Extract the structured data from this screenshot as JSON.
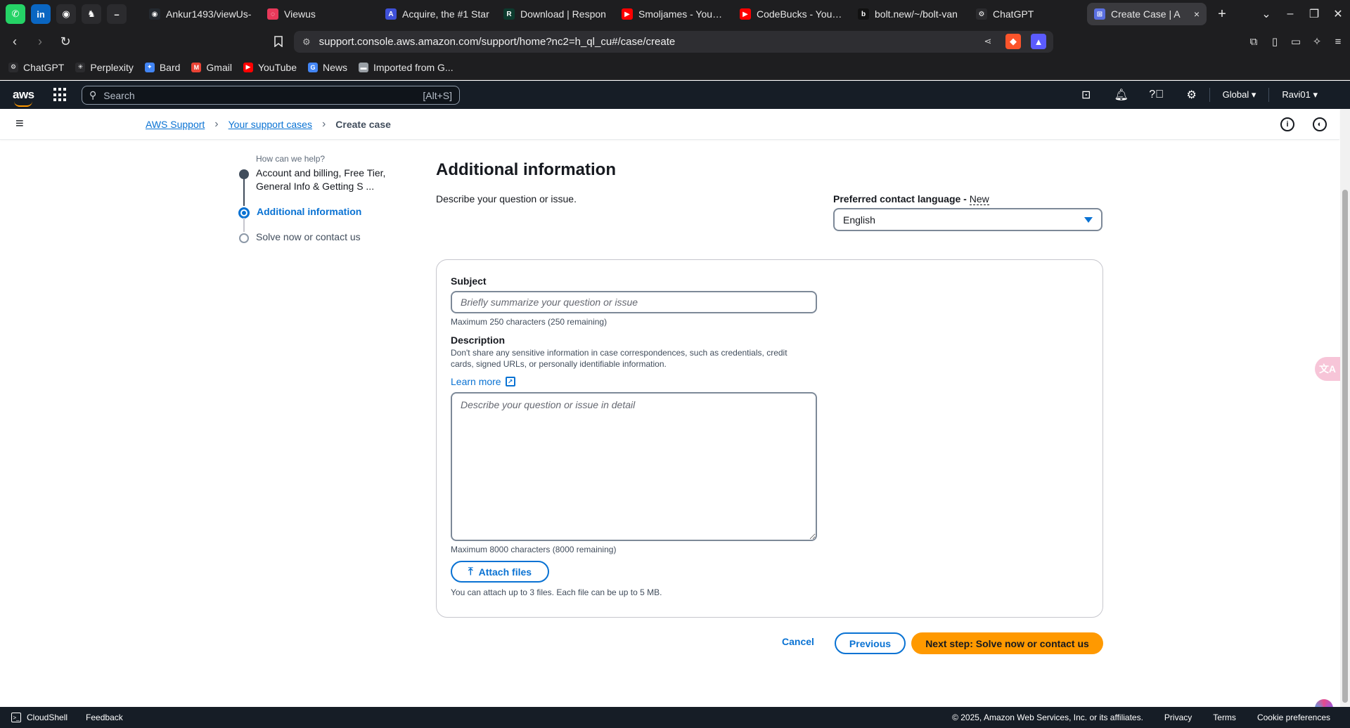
{
  "browser": {
    "pinned": [
      {
        "name": "whatsapp",
        "glyph": "✆",
        "color": "#25d366"
      },
      {
        "name": "linkedin",
        "glyph": "in",
        "color": "#0a66c2"
      },
      {
        "name": "github",
        "glyph": "◉",
        "color": "#2b2b2e"
      },
      {
        "name": "extension",
        "glyph": "♞",
        "color": "#2b2b2e"
      },
      {
        "name": "minimize-app",
        "glyph": "–",
        "color": "#2b2b2e"
      }
    ],
    "tabs": [
      {
        "label": "Ankur1493/viewUs-",
        "fav": "◉",
        "favcolor": "#24292f"
      },
      {
        "label": "Viewus",
        "fav": "◌",
        "favcolor": "#e8395a"
      },
      {
        "label": "Acquire, the #1 Star",
        "fav": "A",
        "favcolor": "#3f51d9"
      },
      {
        "label": "Download | Respon",
        "fav": "R",
        "favcolor": "#0d3b2e"
      },
      {
        "label": "Smoljames - YouTub",
        "fav": "▶",
        "favcolor": "#ff0000"
      },
      {
        "label": "CodeBucks - YouTub",
        "fav": "▶",
        "favcolor": "#ff0000"
      },
      {
        "label": "bolt.new/~/bolt-van",
        "fav": "b",
        "favcolor": "#111111"
      },
      {
        "label": "ChatGPT",
        "fav": "⚙",
        "favcolor": "#2b2b2e"
      },
      {
        "label": "Create Case | A",
        "fav": "⊞",
        "favcolor": "#5a6fe0",
        "active": true
      }
    ],
    "url": "support.console.aws.amazon.com/support/home?nc2=h_ql_cu#/case/create",
    "bookmarks": [
      {
        "label": "ChatGPT",
        "icon": "⚙",
        "color": "#2b2b2e"
      },
      {
        "label": "Perplexity",
        "icon": "✳",
        "color": "#2b2b2e"
      },
      {
        "label": "Bard",
        "icon": "✦",
        "color": "#4285f4"
      },
      {
        "label": "Gmail",
        "icon": "M",
        "color": "#ea4335"
      },
      {
        "label": "YouTube",
        "icon": "▶",
        "color": "#ff0000"
      },
      {
        "label": "News",
        "icon": "G",
        "color": "#4285f4"
      },
      {
        "label": "Imported from G...",
        "icon": "▬",
        "color": "#9aa0a6"
      }
    ]
  },
  "aws_header": {
    "logo": "aws",
    "search_placeholder": "Search",
    "search_hotkey": "[Alt+S]",
    "region": "Global ▾",
    "user": "Ravi01 ▾"
  },
  "breadcrumb": {
    "items": [
      "AWS Support",
      "Your support cases"
    ],
    "current": "Create case"
  },
  "stepper": {
    "heading": "How can we help?",
    "steps": [
      {
        "label": "Account and billing, Free Tier, General Info & Getting S ...",
        "state": "complete"
      },
      {
        "label": "Additional information",
        "state": "current"
      },
      {
        "label": "Solve now or contact us",
        "state": "pending"
      }
    ]
  },
  "form": {
    "title": "Additional information",
    "description": "Describe your question or issue.",
    "language_label": "Preferred contact language - ",
    "language_new": "New",
    "language_value": "English",
    "subject_label": "Subject",
    "subject_placeholder": "Briefly summarize your question or issue",
    "subject_hint": "Maximum 250 characters (250 remaining)",
    "description_label": "Description",
    "description_help": "Don't share any sensitive information in case correspondences, such as credentials, credit cards, signed URLs, or personally identifiable information.",
    "learn_more": "Learn more",
    "description_placeholder": "Describe your question or issue in detail",
    "description_hint": "Maximum 8000 characters (8000 remaining)",
    "attach_label": "Attach files",
    "attach_hint": "You can attach up to 3 files. Each file can be up to 5 MB."
  },
  "actions": {
    "cancel": "Cancel",
    "previous": "Previous",
    "next": "Next step: Solve now or contact us"
  },
  "footer": {
    "cloudshell": "CloudShell",
    "feedback": "Feedback",
    "copyright": "© 2025, Amazon Web Services, Inc. or its affiliates.",
    "privacy": "Privacy",
    "terms": "Terms",
    "cookies": "Cookie preferences"
  },
  "colors": {
    "link": "#0972d3",
    "primary_button": "#ff9900",
    "header_bg": "#161d26"
  }
}
